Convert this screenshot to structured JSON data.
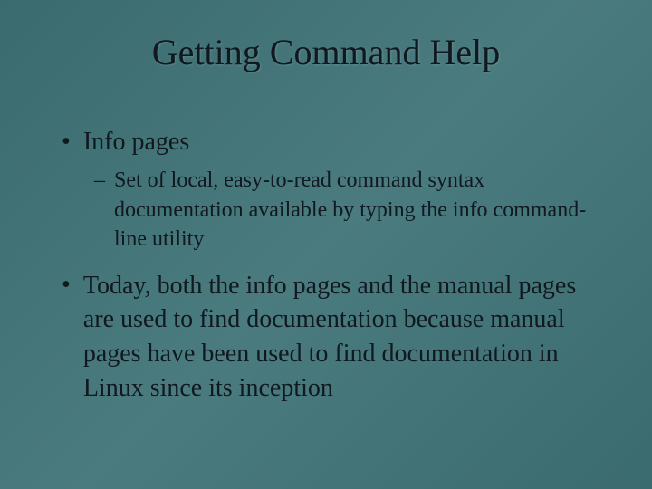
{
  "slide": {
    "title": "Getting Command Help",
    "bullets": [
      {
        "text": "Info pages",
        "subs": [
          "Set of local, easy-to-read command syntax documentation available by typing the info command-line utility"
        ]
      },
      {
        "text": "Today, both the info pages and the manual pages are used to find documentation because manual pages have been used to find documentation in Linux since its inception",
        "subs": []
      }
    ]
  }
}
